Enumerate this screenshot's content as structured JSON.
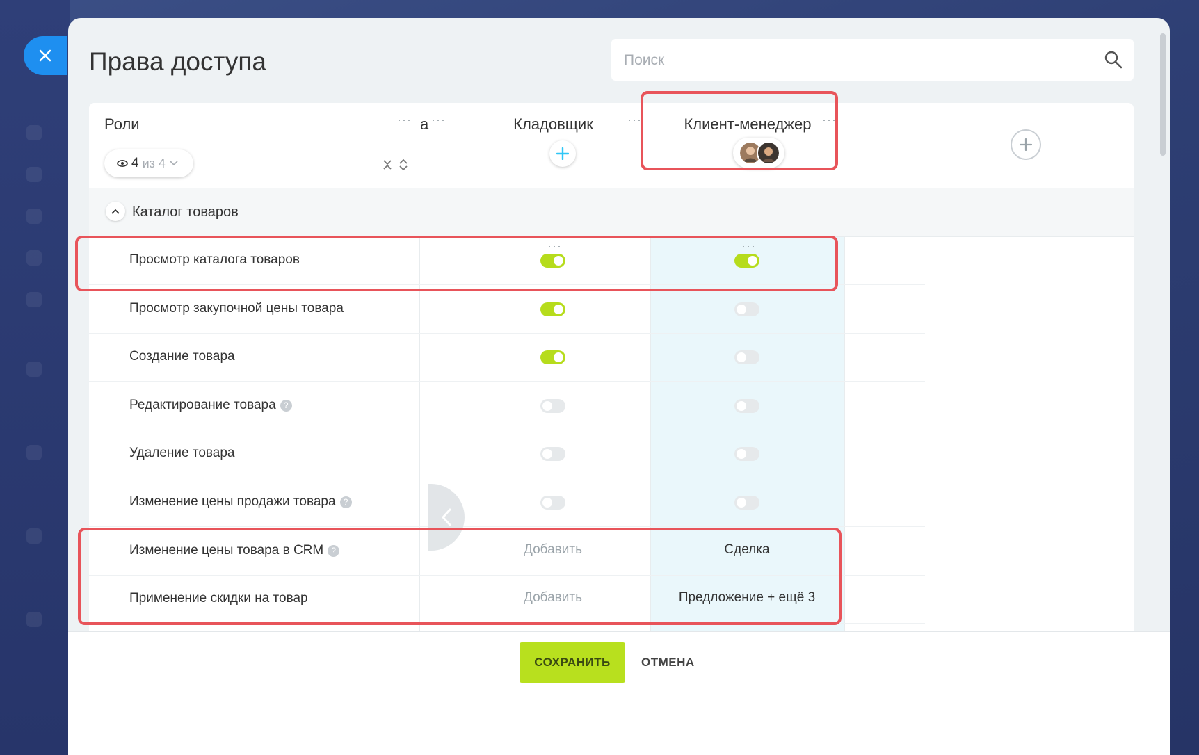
{
  "title": "Права доступа",
  "search": {
    "placeholder": "Поиск"
  },
  "roles_header": {
    "label": "Роли",
    "visible_count": "4",
    "total_label": "из 4",
    "partial_role_tail": "а"
  },
  "roles": [
    {
      "name": "Кладовщик"
    },
    {
      "name": "Клиент-менеджер"
    }
  ],
  "section": {
    "title": "Каталог товаров"
  },
  "permissions": [
    {
      "label": "Просмотр каталога товаров",
      "help": false,
      "kladovshik": "on",
      "klient": "on"
    },
    {
      "label": "Просмотр закупочной цены товара",
      "help": false,
      "kladovshik": "on",
      "klient": "off"
    },
    {
      "label": "Создание товара",
      "help": false,
      "kladovshik": "on",
      "klient": "off"
    },
    {
      "label": "Редактирование товара",
      "help": true,
      "kladovshik": "off",
      "klient": "off"
    },
    {
      "label": "Удаление товара",
      "help": false,
      "kladovshik": "off",
      "klient": "off"
    },
    {
      "label": "Изменение цены продажи товара",
      "help": true,
      "kladovshik": "off",
      "klient": "off"
    },
    {
      "label": "Изменение цены товара в CRM",
      "help": true,
      "kladovshik": "Добавить",
      "klient": "Сделка"
    },
    {
      "label": "Применение скидки на товар",
      "help": false,
      "kladovshik": "Добавить",
      "klient": "Предложение + ещё 3"
    }
  ],
  "help_mark": "?",
  "menu_dots": "···",
  "footer": {
    "save_label": "СОХРАНИТЬ",
    "cancel_label": "ОТМЕНА"
  },
  "colors": {
    "accent_green": "#b6dc1c",
    "highlight_red": "#e8545a",
    "close_blue": "#1e8ff0",
    "selected_column": "#eaf7fb"
  }
}
